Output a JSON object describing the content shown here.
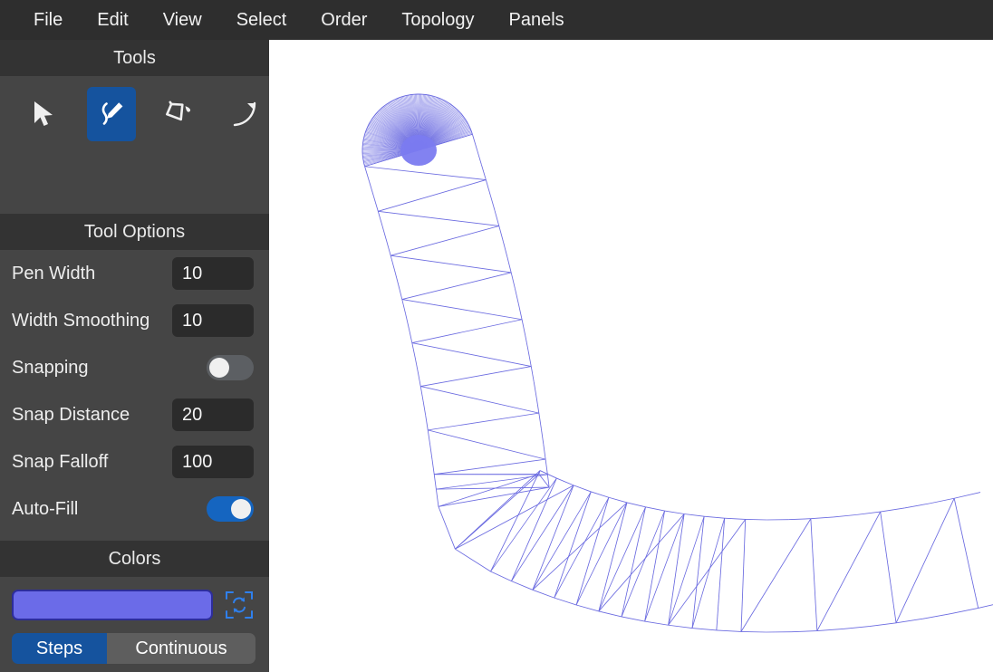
{
  "menubar": {
    "items": [
      {
        "label": "File"
      },
      {
        "label": "Edit"
      },
      {
        "label": "View"
      },
      {
        "label": "Select"
      },
      {
        "label": "Order"
      },
      {
        "label": "Topology"
      },
      {
        "label": "Panels"
      }
    ]
  },
  "tools_panel": {
    "title": "Tools",
    "active_tool": "pen",
    "tools": [
      {
        "name": "select-cursor",
        "icon": "cursor-arrow-icon",
        "active": false
      },
      {
        "name": "pen",
        "icon": "pencil-icon",
        "active": true
      },
      {
        "name": "fill",
        "icon": "paint-bucket-icon",
        "active": false
      },
      {
        "name": "curve",
        "icon": "curve-icon",
        "active": false
      }
    ]
  },
  "tool_options": {
    "title": "Tool Options",
    "rows": [
      {
        "label": "Pen Width",
        "type": "number",
        "value": "10"
      },
      {
        "label": "Width Smoothing",
        "type": "number",
        "value": "10"
      },
      {
        "label": "Snapping",
        "type": "toggle",
        "value": "off"
      },
      {
        "label": "Snap Distance",
        "type": "number",
        "value": "20"
      },
      {
        "label": "Snap Falloff",
        "type": "number",
        "value": "100"
      },
      {
        "label": "Auto-Fill",
        "type": "toggle",
        "value": "on"
      }
    ]
  },
  "colors": {
    "title": "Colors",
    "swatch_color": "#6b6be8",
    "swatch_border": "#2d2d9c",
    "randomize_icon": "refresh-icon",
    "mode_tabs": [
      {
        "label": "Steps",
        "active": true
      },
      {
        "label": "Continuous",
        "active": false
      }
    ]
  },
  "theme": {
    "menubar_bg": "#2e2e2e",
    "panel_bg": "#454545",
    "header_bg": "#333333",
    "input_bg": "#2b2b2b",
    "accent_blue": "#15539e",
    "toggle_on": "#1565c0",
    "toggle_off": "#5c5f63",
    "canvas_bg": "#ffffff",
    "mesh_stroke": "#6a6ae0"
  },
  "canvas": {
    "name": "drawing-canvas",
    "mesh_stroke": "#6a6ae0",
    "cap_fill": "#7b7bf0",
    "description": "Triangulated wireframe ribbon stroke curving from upper-left down and to the right"
  }
}
